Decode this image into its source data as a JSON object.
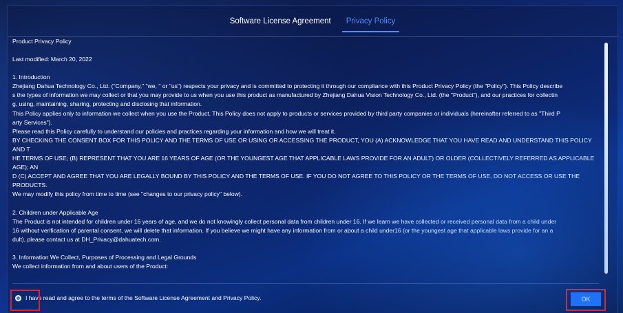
{
  "tabs": [
    {
      "label": "Software License Agreement",
      "active": false
    },
    {
      "label": "Privacy Policy",
      "active": true
    }
  ],
  "policy": {
    "title": "Product Privacy Policy",
    "last_modified": "Last modified: March 20, 2022",
    "sections": [
      {
        "heading": "1. Introduction",
        "lines": [
          "Zhejiang Dahua Technology Co., Ltd. (\"Company,\" \"we, \" or \"us\") respects your privacy and is committed to protecting it through our compliance with this Product Privacy Policy (the \"Policy\"). This Policy describe",
          "s the types of information we may collect or that you may provide to us when you use this product as manufactured by Zhejiang Dahua Vision Technology Co., Ltd. (the \"Product\"), and our practices for collectin",
          "g, using, maintaining, sharing, protecting and disclosing that information.",
          "This Policy applies only to information we collect when you use the Product. This Policy does not apply to products or services provided by third party companies or individuals (hereinafter referred to as \"Third P",
          "arty Services\").",
          "Please read this Policy carefully to understand our policies and practices regarding your information and how we will treat it.",
          "BY CHECKING THE CONSENT BOX FOR THIS POLICY AND THE TERMS OF USE OR USING OR ACCESSING THE PRODUCT, YOU (A) ACKNOWLEDGE THAT YOU HAVE READ AND UNDERSTAND THIS POLICY AND T",
          "HE TERMS OF USE; (B) REPRESENT THAT YOU ARE 16 YEARS OF AGE (OR THE YOUNGEST AGE THAT APPLICABLE LAWS PROVIDE FOR AN ADULT) OR OLDER (COLLECTIVELY REFERRED AS APPLICABLE AGE); AN",
          "D (C) ACCEPT AND AGREE THAT YOU ARE LEGALLY BOUND BY THIS POLICY AND THE TERMS OF USE.  IF YOU DO NOT AGREE TO THIS POLICY OR THE TERMS OF USE, DO NOT ACCESS OR USE THE PRODUCTS.",
          "We may modify this policy from time to time (see \"changes to our privacy policy\" below)."
        ]
      },
      {
        "heading": "2. Children under Applicable Age",
        "lines": [
          "The Product is not intended for children under 16 years of age, and we do not knowingly collect personal data from children under 16. If we learn we have collected or received personal data from a child under",
          "16 without verification of parental consent, we will delete that information. If you believe we might have any information from or about a child under16 (or the youngest age that applicable laws provide for an a",
          "dult), please contact us at DH_Privacy@dahuatech.com."
        ]
      },
      {
        "heading": "3. Information We Collect, Purposes of Processing and Legal Grounds",
        "lines": [
          "We collect information from and about users of the Product:"
        ]
      }
    ]
  },
  "agreement": {
    "label": "I have read and agree to the terms of the Software License Agreement and Privacy Policy.",
    "checked": true
  },
  "ok_label": "OK",
  "colors": {
    "accent": "#4c8dff",
    "ok_button": "#1f6ff5",
    "highlight": "#e0202a"
  }
}
